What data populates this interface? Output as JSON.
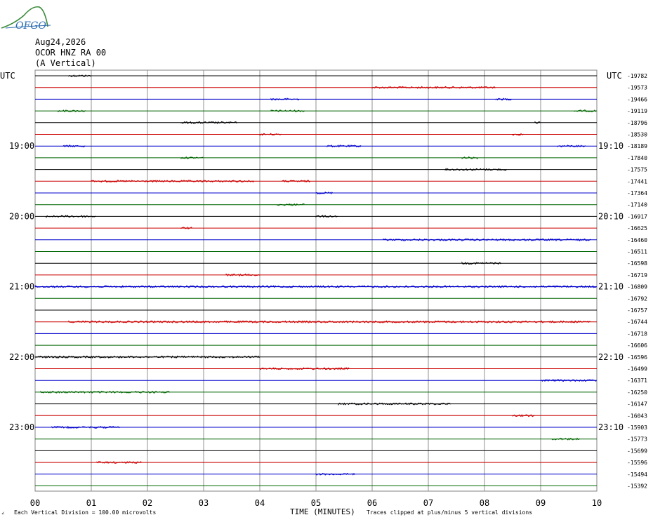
{
  "logo": {
    "text": "OFGO",
    "color": "#2b6cb0",
    "hill_color": "#3a8a3a"
  },
  "header": {
    "date": "Aug24,2026",
    "station": "OCOR HNZ RA 00",
    "component": "(A Vertical)"
  },
  "chart_data": {
    "type": "helicorder",
    "left_axis_label": "UTC",
    "right_axis_label": "UTC",
    "left_time_labels": [
      "19:00",
      "20:00",
      "21:00",
      "22:00",
      "23:00"
    ],
    "right_time_labels": [
      "19:10",
      "20:10",
      "21:10",
      "22:10",
      "23:10"
    ],
    "label_rows": [
      6,
      12,
      18,
      24,
      30
    ],
    "x_ticks": [
      "00",
      "01",
      "02",
      "03",
      "04",
      "05",
      "06",
      "07",
      "08",
      "09",
      "10"
    ],
    "xlim": [
      0,
      10
    ],
    "xlabel": "TIME (MINUTES)",
    "rows": 36,
    "trace_colors": [
      "#000000",
      "#cc0000",
      "#0000cc",
      "#006600"
    ],
    "offsets": [
      "-19782",
      "-19573",
      "-19466",
      "-19119",
      "-18796",
      "-18530",
      "-18189",
      "-17840",
      "-17575",
      "-17441",
      "-17364",
      "-17140",
      "-16917",
      "-16625",
      "-16460",
      "-16511",
      "-16598",
      "-16719",
      "-16809",
      "-16792",
      "-16757",
      "-16744",
      "-16718",
      "-16606",
      "-16596",
      "-16499",
      "-16371",
      "-16250",
      "-16147",
      "-16043",
      "-15903",
      "-15773",
      "-15699",
      "-15596",
      "-15494",
      "-15392"
    ],
    "bursts": [
      [
        [
          0.6,
          1.0
        ]
      ],
      [
        [
          6.0,
          8.2
        ]
      ],
      [
        [
          4.2,
          4.7
        ],
        [
          8.2,
          8.5
        ]
      ],
      [
        [
          0.4,
          0.9
        ],
        [
          4.2,
          4.8
        ],
        [
          9.6,
          10.0
        ]
      ],
      [
        [
          2.6,
          3.6
        ],
        [
          8.9,
          9.0
        ]
      ],
      [
        [
          4.0,
          4.4
        ],
        [
          8.5,
          8.7
        ]
      ],
      [
        [
          0.5,
          0.9
        ],
        [
          5.2,
          5.8
        ],
        [
          9.3,
          9.8
        ]
      ],
      [
        [
          2.6,
          3.0
        ],
        [
          7.6,
          7.9
        ]
      ],
      [
        [
          7.3,
          8.4
        ]
      ],
      [
        [
          1.0,
          3.9
        ],
        [
          4.4,
          4.9
        ]
      ],
      [
        [
          5.0,
          5.3
        ]
      ],
      [
        [
          4.3,
          4.8
        ]
      ],
      [
        [
          0.2,
          1.1
        ],
        [
          5.0,
          5.4
        ]
      ],
      [
        [
          2.6,
          2.8
        ]
      ],
      [
        [
          6.2,
          9.9
        ]
      ],
      [],
      [
        [
          7.6,
          8.3
        ]
      ],
      [
        [
          3.4,
          4.0
        ]
      ],
      [
        [
          0.0,
          10.0
        ]
      ],
      [],
      [],
      [
        [
          0.6,
          9.9
        ]
      ],
      [],
      [],
      [
        [
          0.0,
          4.0
        ]
      ],
      [
        [
          4.0,
          5.6
        ]
      ],
      [
        [
          9.0,
          10.0
        ]
      ],
      [
        [
          0.1,
          2.4
        ]
      ],
      [
        [
          5.4,
          7.4
        ]
      ],
      [
        [
          8.5,
          8.9
        ]
      ],
      [
        [
          0.3,
          1.5
        ]
      ],
      [
        [
          9.2,
          9.7
        ]
      ],
      [],
      [
        [
          1.1,
          1.9
        ]
      ],
      [
        [
          5.0,
          5.7
        ]
      ],
      []
    ]
  },
  "footer": {
    "left_mark": "∠",
    "scale_note": "Each Vertical Division =  100.00 microvolts",
    "clip_note": "Traces clipped at plus/minus 5 vertical divisions"
  }
}
